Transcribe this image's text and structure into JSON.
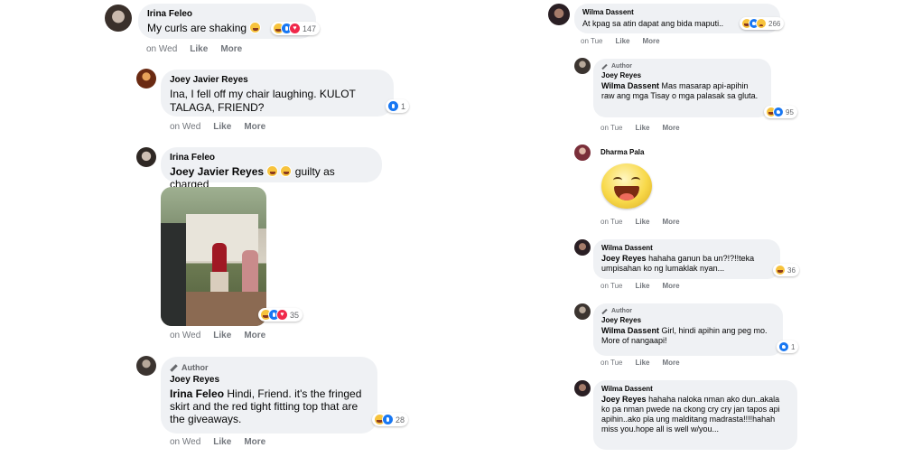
{
  "colors": {
    "bubble": "#eff1f4",
    "meta": "#72767c",
    "like": "#1877f2",
    "love": "#f0284a",
    "haha": "#f7c33d"
  },
  "left": [
    {
      "id": "c1",
      "name": "Irina Feleo",
      "text": "My curls are shaking",
      "reactions": [
        "haha",
        "like",
        "love"
      ],
      "count": "147",
      "time": "on Wed",
      "like": "Like",
      "more": "More"
    },
    {
      "id": "c2",
      "name": "Joey Javier Reyes",
      "text": "Ina, I fell off my chair laughing. KULOT TALAGA, FRIEND?",
      "reactions": [
        "like"
      ],
      "count": "1",
      "time": "on Wed",
      "like": "Like",
      "more": "More"
    },
    {
      "id": "c3",
      "name": "Irina Feleo",
      "mention": "Joey Javier Reyes",
      "text": "guilty as charged",
      "reactions": [
        "haha",
        "like",
        "love"
      ],
      "count": "35",
      "time": "on Wed",
      "like": "Like",
      "more": "More"
    },
    {
      "id": "c4",
      "author": "Author",
      "name": "Joey Reyes",
      "mention": "Irina Feleo",
      "text": "Hindi, Friend. it's the fringed skirt and the red tight fitting top that are the giveaways.",
      "reactions": [
        "haha",
        "like"
      ],
      "count": "28",
      "time": "on Wed",
      "like": "Like",
      "more": "More"
    }
  ],
  "right": [
    {
      "id": "r1",
      "name": "Wilma Dassent",
      "text": "At kpag sa atin dapat ang bida maputi..",
      "reactions": [
        "haha",
        "like",
        "sad"
      ],
      "count": "266",
      "time": "on Tue",
      "like": "Like",
      "more": "More"
    },
    {
      "id": "r2",
      "author": "Author",
      "name": "Joey Reyes",
      "mention": "Wilma Dassent",
      "text": "Mas masarap api-apihin raw ang mga Tisay o mga palasak sa gluta.",
      "reactions": [
        "haha",
        "like"
      ],
      "count": "95",
      "time": "on Tue",
      "like": "Like",
      "more": "More"
    },
    {
      "id": "r3",
      "name": "Dharma Pala",
      "time": "on Tue",
      "like": "Like",
      "more": "More"
    },
    {
      "id": "r4",
      "name": "Wilma Dassent",
      "mention": "Joey Reyes",
      "text": "hahaha ganun ba un?!?!!teka umpisahan ko ng lumaklak nyan...",
      "reactions": [
        "haha"
      ],
      "count": "36",
      "time": "on Tue",
      "like": "Like",
      "more": "More"
    },
    {
      "id": "r5",
      "author": "Author",
      "name": "Joey Reyes",
      "mention": "Wilma Dassent",
      "text": "Girl, hindi apihin ang peg mo. More of nangaapi!",
      "reactions": [
        "like"
      ],
      "count": "1",
      "time": "on Tue",
      "like": "Like",
      "more": "More"
    },
    {
      "id": "r6",
      "name": "Wilma Dassent",
      "mention": "Joey Reyes",
      "text": "hahaha naloka nman ako dun..akala ko pa nman pwede na ckong cry cry jan tapos api apihin..ako pla ung malditang madrasta!!!!hahah miss you.hope all is well w/you..."
    }
  ]
}
